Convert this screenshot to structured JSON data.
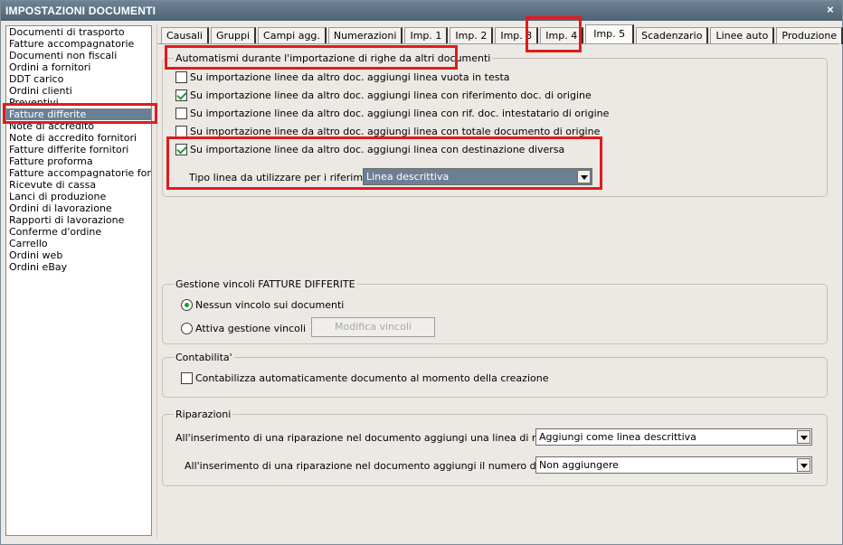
{
  "window": {
    "title": "IMPOSTAZIONI DOCUMENTI",
    "close_glyph": "×"
  },
  "left_list": {
    "items": [
      "Documenti di trasporto",
      "Fatture accompagnatorie",
      "Documenti non fiscali",
      "Ordini a fornitori",
      "DDT carico",
      "Ordini clienti",
      "Preventivi",
      "Fatture differite",
      "Note di accredito",
      "Note di accredito fornitori",
      "Fatture differite fornitori",
      "Fatture proforma",
      "Fatture accompagnatorie fornito",
      "Ricevute di cassa",
      "Lanci di produzione",
      "Ordini di lavorazione",
      "Rapporti di lavorazione",
      "Conferme d'ordine",
      "Carrello",
      "Ordini web",
      "Ordini eBay"
    ],
    "selected": "Fatture differite"
  },
  "tabs": {
    "items": [
      "Causali",
      "Gruppi",
      "Campi agg.",
      "Numerazioni",
      "Imp. 1",
      "Imp. 2",
      "Imp. 3",
      "Imp. 4",
      "Imp. 5",
      "Scadenzario",
      "Linee auto",
      "Produzione"
    ],
    "active": "Imp. 5"
  },
  "automatismi": {
    "legend": "Automatismi durante l'importazione di righe da altri documenti",
    "checks": [
      {
        "label": "Su importazione linee da altro doc. aggiungi linea vuota in testa",
        "checked": false
      },
      {
        "label": "Su importazione linee da altro doc. aggiungi linea con riferimento doc. di origine",
        "checked": true
      },
      {
        "label": "Su importazione linee da altro doc. aggiungi linea con rif. doc. intestatario di origine",
        "checked": false
      },
      {
        "label": "Su importazione linee da altro doc. aggiungi linea con totale documento di origine",
        "checked": false
      },
      {
        "label": "Su importazione linee da altro doc. aggiungi linea con destinazione diversa",
        "checked": true
      }
    ],
    "tipo_linea_label": "Tipo linea da utilizzare per i riferimenti :",
    "tipo_linea_value": "Linea descrittiva"
  },
  "vincoli": {
    "legend": "Gestione vincoli FATTURE DIFFERITE",
    "radio1": "Nessun vincolo sui documenti",
    "radio2": "Attiva gestione vincoli",
    "selected": "Nessun vincolo sui documenti",
    "modifica_button": "Modifica vincoli"
  },
  "contabilita": {
    "legend": "Contabilita'",
    "check_label": "Contabilizza automaticamente documento al momento della creazione",
    "checked": false
  },
  "riparazioni": {
    "legend": "Riparazioni",
    "row1_label": "All'inserimento di una riparazione nel documento aggiungi una linea di riferimento :",
    "row1_value": "Aggiungi come linea descrittiva",
    "row2_label": "All'inserimento di una riparazione nel documento aggiungi il numero di matricola :",
    "row2_value": "Non aggiungere"
  },
  "colors": {
    "titlebar": "#5b6f82",
    "selection": "#6b7f93",
    "highlight": "#e11b1b",
    "check": "#1f9b2e"
  }
}
